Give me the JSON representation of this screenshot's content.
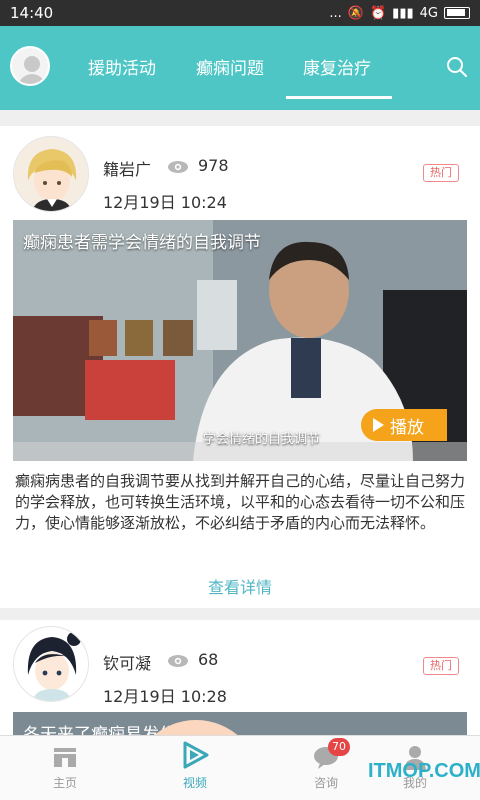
{
  "status_bar": {
    "time": "14:40",
    "dots": "...",
    "network": "4G"
  },
  "header": {
    "tabs": [
      {
        "label": "援助活动"
      },
      {
        "label": "癫痫问题"
      },
      {
        "label": "康复治疗"
      }
    ],
    "active_tab_index": 2,
    "icons": {
      "avatar": "default-avatar-icon",
      "search": "search-icon"
    },
    "colors": {
      "brand": "#4fc6c6"
    }
  },
  "feed": {
    "posts": [
      {
        "author": "籍岩广",
        "views": "978",
        "date": "12月19日 10:24",
        "badge": "热门",
        "video_title": "癫痫患者需学会情绪的自我调节",
        "video_caption": "学会情绪的自我调节",
        "play_label": "播放",
        "description": "癫痫病患者的自我调节要从找到并解开自己的心结，尽量让自己努力的学会释放，也可转换生活环境，以平和的心态去看待一切不公和压力，使心情能够逐渐放松，不必纠结于矛盾的内心而无法释怀。",
        "detail_link": "查看详情"
      },
      {
        "author": "钦可凝",
        "views": "68",
        "date": "12月19日 10:28",
        "badge": "热门",
        "video_title": "冬天来了癫痫易发作怎么办"
      }
    ]
  },
  "bottom_nav": {
    "items": [
      {
        "label": "主页",
        "icon": "home-icon"
      },
      {
        "label": "视频",
        "icon": "video-play-icon"
      },
      {
        "label": "咨询",
        "icon": "chat-icon",
        "badge": "70"
      },
      {
        "label": "我的",
        "icon": "user-icon"
      }
    ],
    "active_index": 1,
    "colors": {
      "active": "#3aa8b8",
      "badge": "#e54545"
    }
  },
  "watermark": "ITMOP.COM"
}
